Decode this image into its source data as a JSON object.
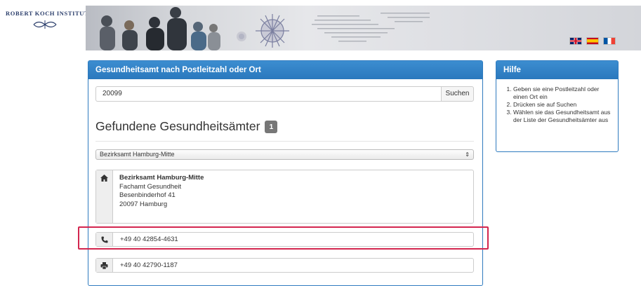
{
  "header": {
    "logo_text": "ROBERT KOCH INSTITUT",
    "languages": [
      {
        "name": "uk-flag-icon"
      },
      {
        "name": "spain-flag-icon"
      },
      {
        "name": "france-flag-icon"
      }
    ]
  },
  "main_panel": {
    "title": "Gesundheitsamt nach Postleitzahl oder Ort",
    "search": {
      "value": "20099",
      "button_label": "Suchen"
    },
    "results_title": "Gefundene Gesundheitsämter",
    "results_count": "1",
    "select_value": "Bezirksamt Hamburg-Mitte",
    "address": {
      "name": "Bezirksamt Hamburg-Mitte",
      "department": "Fachamt Gesundheit",
      "street": "Besenbinderhof 41",
      "city": "20097 Hamburg"
    },
    "phone": "+49 40 42854-4631",
    "fax": "+49 40 42790-1187"
  },
  "help_panel": {
    "title": "Hilfe",
    "steps": [
      "Geben sie eine Postleitzahl oder einen Ort ein",
      "Drücken sie auf Suchen",
      "Wählen sie das Gesundheitsamt aus der Liste der Gesundheitsämter aus"
    ]
  },
  "colors": {
    "panel_header": "#2f7bbf",
    "highlight": "#d3264f",
    "logo": "#2b3e6b"
  }
}
